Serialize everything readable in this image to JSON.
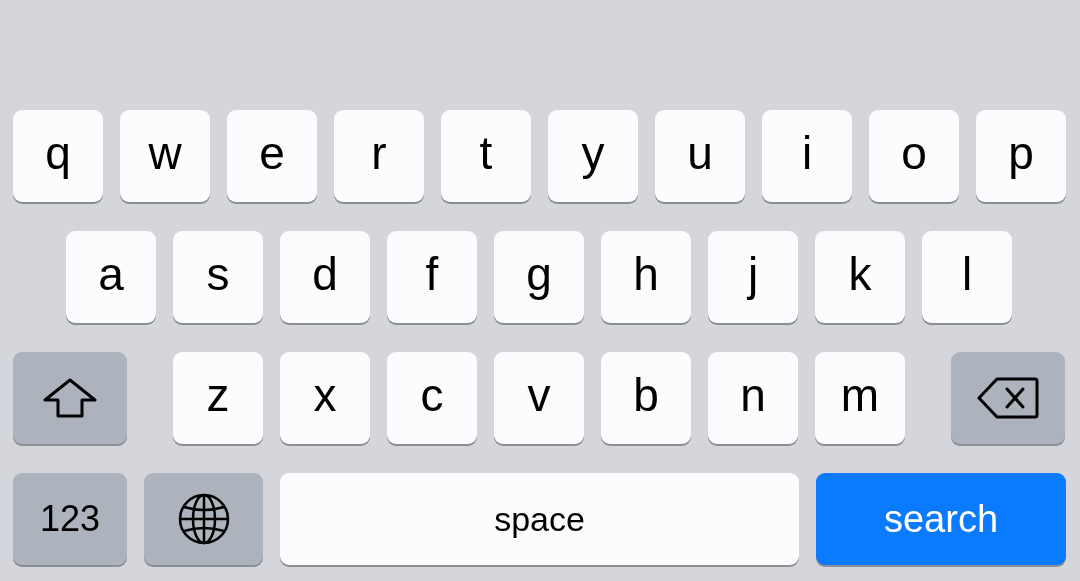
{
  "keyboard": {
    "rows": [
      {
        "keys": [
          {
            "kind": "letter",
            "label": "q"
          },
          {
            "kind": "letter",
            "label": "w"
          },
          {
            "kind": "letter",
            "label": "e"
          },
          {
            "kind": "letter",
            "label": "r"
          },
          {
            "kind": "letter",
            "label": "t"
          },
          {
            "kind": "letter",
            "label": "y"
          },
          {
            "kind": "letter",
            "label": "u"
          },
          {
            "kind": "letter",
            "label": "i"
          },
          {
            "kind": "letter",
            "label": "o"
          },
          {
            "kind": "letter",
            "label": "p"
          }
        ]
      },
      {
        "keys": [
          {
            "kind": "letter",
            "label": "a"
          },
          {
            "kind": "letter",
            "label": "s"
          },
          {
            "kind": "letter",
            "label": "d"
          },
          {
            "kind": "letter",
            "label": "f"
          },
          {
            "kind": "letter",
            "label": "g"
          },
          {
            "kind": "letter",
            "label": "h"
          },
          {
            "kind": "letter",
            "label": "j"
          },
          {
            "kind": "letter",
            "label": "k"
          },
          {
            "kind": "letter",
            "label": "l"
          }
        ]
      },
      {
        "keys": [
          {
            "kind": "shift"
          },
          {
            "kind": "letter",
            "label": "z"
          },
          {
            "kind": "letter",
            "label": "x"
          },
          {
            "kind": "letter",
            "label": "c"
          },
          {
            "kind": "letter",
            "label": "v"
          },
          {
            "kind": "letter",
            "label": "b"
          },
          {
            "kind": "letter",
            "label": "n"
          },
          {
            "kind": "letter",
            "label": "m"
          },
          {
            "kind": "backspace"
          }
        ]
      },
      {
        "keys": [
          {
            "kind": "number",
            "label": "123"
          },
          {
            "kind": "globe"
          },
          {
            "kind": "space",
            "label": "space"
          },
          {
            "kind": "action",
            "label": "search"
          }
        ]
      }
    ]
  }
}
